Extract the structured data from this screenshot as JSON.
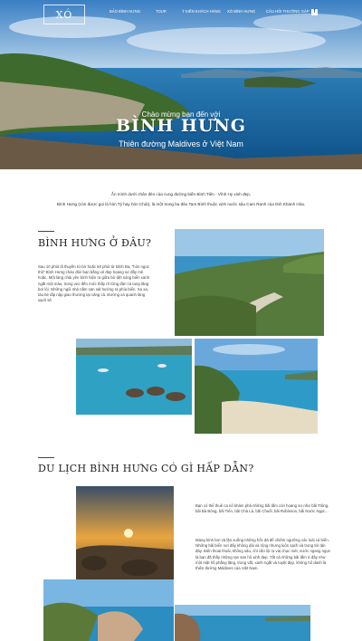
{
  "nav": {
    "logo": "XÓ",
    "items": [
      {
        "label": "Bảo Bình Hưng"
      },
      {
        "label": "Tour"
      },
      {
        "label": "Ý kiến khách hàng"
      },
      {
        "label": "Xó Bình Hưng"
      },
      {
        "label": "Câu hỏi thường gặp"
      }
    ],
    "facebook": "f"
  },
  "hero": {
    "welcome": "Chào mừng bạn đến với",
    "title": "BÌNH HƯNG",
    "subtitle": "Thiên đường Maldives ở Việt Nam"
  },
  "intro": {
    "line1": "Ẩn mình dưới chân đèo của cung đường biển Bình Tiên - Vĩnh Hy xinh đẹp,",
    "line2": "Bình Hưng (còn được gọi là hòn Tý hay hòn Chút), là một trong ba đảo Tam Bình thuộc vịnh nước sâu Cam Ranh của tỉnh Khánh Hòa."
  },
  "section1": {
    "heading": "BÌNH HƯNG Ở ĐÂU?",
    "text": "Sau 10 phút đi thuyền từ bờ hoặc 60 phút từ Bình Ba, \"hòn ngọc thô\" Bình Hưng chào đón bạn bằng vẻ đẹp hoang sơ đầy mê hoặc. Một làng chài yên bình hiện ra giữa bờ dệt sóng biển xanh ngắt một màu, trong veo đến mức thấy rõ từng đàn cá tung tăng bơi lội. Những ngôi nhà nằm san sát hướng ra phía biển. Xa xa, tàu bè tấp nập giao thương tại cảng cá. Đường xá quanh làng sạch sẽ."
  },
  "section2": {
    "heading": "DU LỊCH BÌNH HƯNG CÓ GÌ HẤP DẪN?",
    "text1": "Bạn có thể thuê ca nô khám phá những bãi tắm còn hoang sơ như bãi Trũng, bãi Bà Bóng, bãi Tiên, bãi Chà Là, bãi Chuối, bãi Robinson, bãi Nước Ngọt…",
    "text2": "Mang kính bơi và lặn xuống những hốc đá để chiêm ngưỡng các loài cá biển. Những bãi biển nơi đây không dài và rộng nhưng luôn sạch và trong tới tận đáy. Biển thoai thoải, không sâu, chỉ cần lội ra vài chục mét, nước ngang ngực là bạn đã thấy những rạn san hô xinh đẹp. Tất cả những bãi tắm ở đây như một mặt hồ phẳng lặng, trong vắt, xanh ngắt và tuyệt đẹp, không hổ danh là thiên đường Maldives của Việt Nam."
  }
}
